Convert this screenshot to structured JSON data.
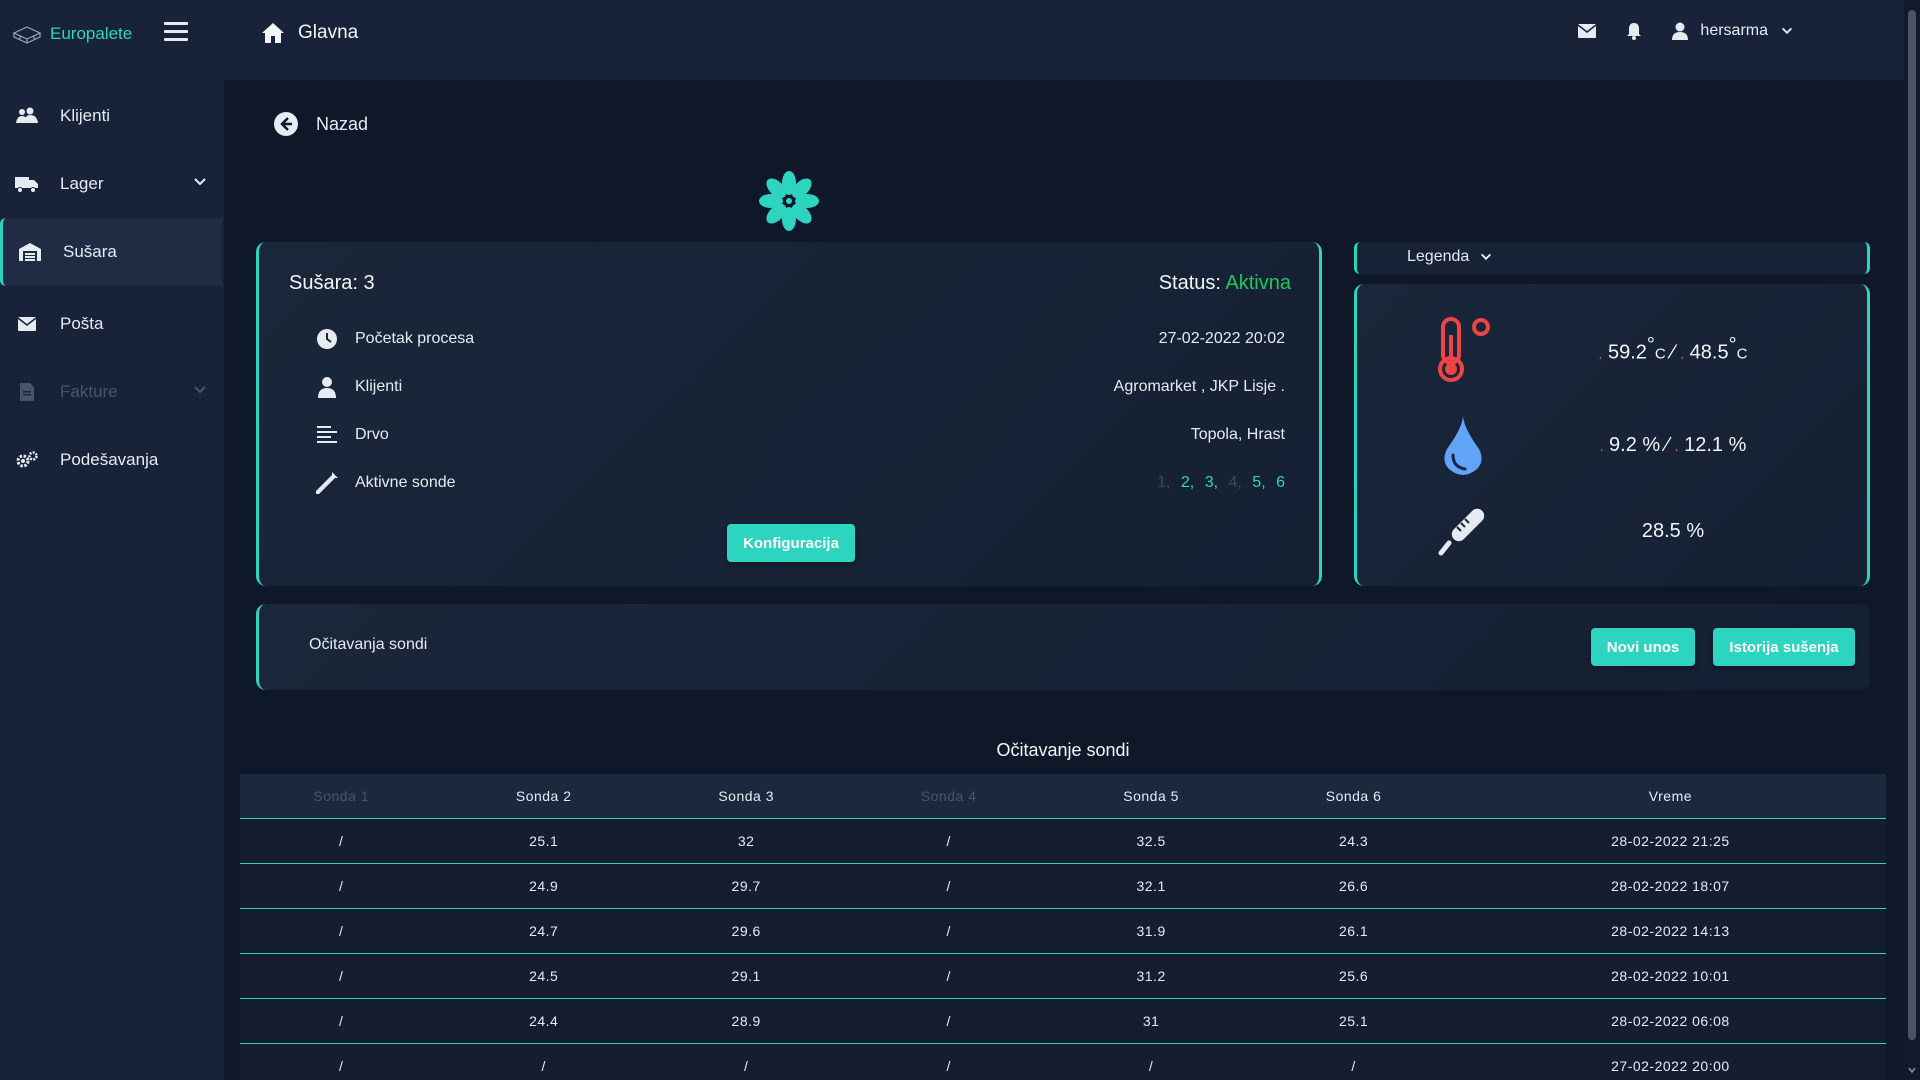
{
  "brand": {
    "name": "Europalete"
  },
  "sidebar": {
    "items": [
      {
        "label": "Klijenti"
      },
      {
        "label": "Lager"
      },
      {
        "label": "Sušara"
      },
      {
        "label": "Pošta"
      },
      {
        "label": "Fakture"
      },
      {
        "label": "Podešavanja"
      }
    ]
  },
  "topbar": {
    "title": "Glavna",
    "username": "hersarma"
  },
  "back": {
    "label": "Nazad"
  },
  "card": {
    "title": "Sušara: 3",
    "status_label": "Status:",
    "status_value": "Aktivna",
    "rows": [
      {
        "label": "Početak procesa",
        "value": "27-02-2022 20:02"
      },
      {
        "label": "Klijenti",
        "value": "Agromarket , JKP Lisje ."
      },
      {
        "label": "Drvo",
        "value": "Topola, Hrast"
      },
      {
        "label": "Aktivne sonde"
      }
    ],
    "sonde": [
      {
        "n": "1,",
        "active": false
      },
      {
        "n": "2,",
        "active": true
      },
      {
        "n": "3,",
        "active": true
      },
      {
        "n": "4,",
        "active": false
      },
      {
        "n": "5,",
        "active": true
      },
      {
        "n": "6",
        "active": true
      }
    ],
    "config_button": "Konfiguracija"
  },
  "legend": {
    "toggle": "Legenda",
    "temp": {
      "v1": "59.2",
      "v2": "48.5",
      "unit": "C"
    },
    "humidity": {
      "v1": "9.2",
      "v2": "12.1",
      "unit": "%"
    },
    "moisture": {
      "v1": "28.5",
      "unit": "%"
    }
  },
  "readings": {
    "title": "Očitavanja sondi",
    "new_button": "Novi unos",
    "history_button": "Istorija sušenja"
  },
  "table": {
    "title": "Očitavanje sondi",
    "headers": [
      {
        "label": "Sonda 1",
        "dim": true
      },
      {
        "label": "Sonda 2",
        "dim": false
      },
      {
        "label": "Sonda 3",
        "dim": false
      },
      {
        "label": "Sonda 4",
        "dim": true
      },
      {
        "label": "Sonda 5",
        "dim": false
      },
      {
        "label": "Sonda 6",
        "dim": false
      },
      {
        "label": "Vreme",
        "dim": false
      }
    ],
    "rows": [
      [
        "/",
        "25.1",
        "32",
        "/",
        "32.5",
        "24.3",
        "28-02-2022 21:25"
      ],
      [
        "/",
        "24.9",
        "29.7",
        "/",
        "32.1",
        "26.6",
        "28-02-2022 18:07"
      ],
      [
        "/",
        "24.7",
        "29.6",
        "/",
        "31.9",
        "26.1",
        "28-02-2022 14:13"
      ],
      [
        "/",
        "24.5",
        "29.1",
        "/",
        "31.2",
        "25.6",
        "28-02-2022 10:01"
      ],
      [
        "/",
        "24.4",
        "28.9",
        "/",
        "31",
        "25.1",
        "28-02-2022 06:08"
      ],
      [
        "/",
        "/",
        "/",
        "/",
        "/",
        "/",
        "27-02-2022 20:00"
      ]
    ]
  },
  "colors": {
    "accent": "#2dd4bf",
    "status_active": "#22c55e",
    "background": "#0f1829",
    "sidebar": "#18233a"
  }
}
